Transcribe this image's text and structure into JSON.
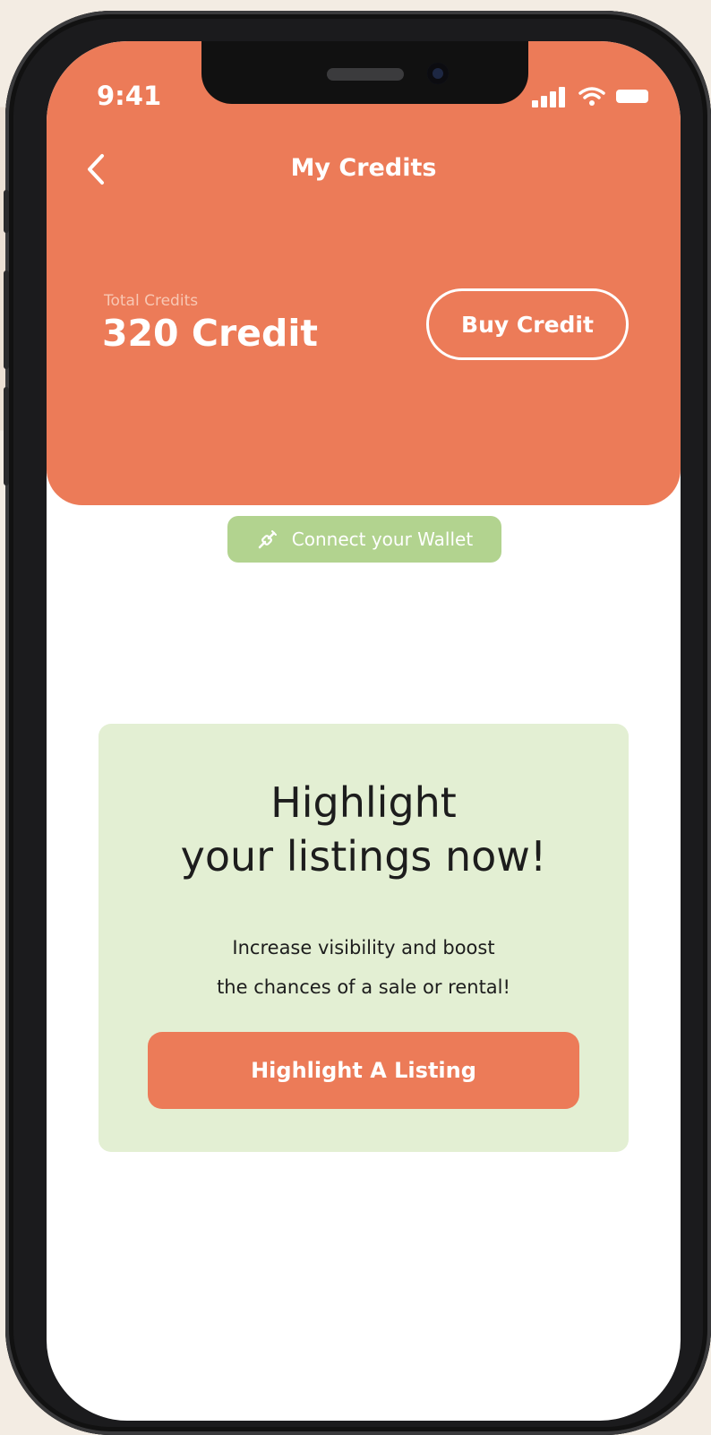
{
  "status_bar": {
    "time": "9:41"
  },
  "header": {
    "title": "My Credits",
    "total_label": "Total Credits",
    "total_value": "320 Credit",
    "buy_button": "Buy Credit"
  },
  "wallet": {
    "label": "Connect your Wallet",
    "icon": "link-icon"
  },
  "promo": {
    "title_line1": "Highlight",
    "title_line2": "your listings now!",
    "subtitle_line1": "Increase visibility and boost",
    "subtitle_line2": "the chances of a sale or rental!",
    "button": "Highlight A Listing"
  },
  "colors": {
    "accent": "#ec7b58",
    "wallet_green": "#b2d38f",
    "card_green": "#e3efd3",
    "background": "#f3ece3"
  }
}
